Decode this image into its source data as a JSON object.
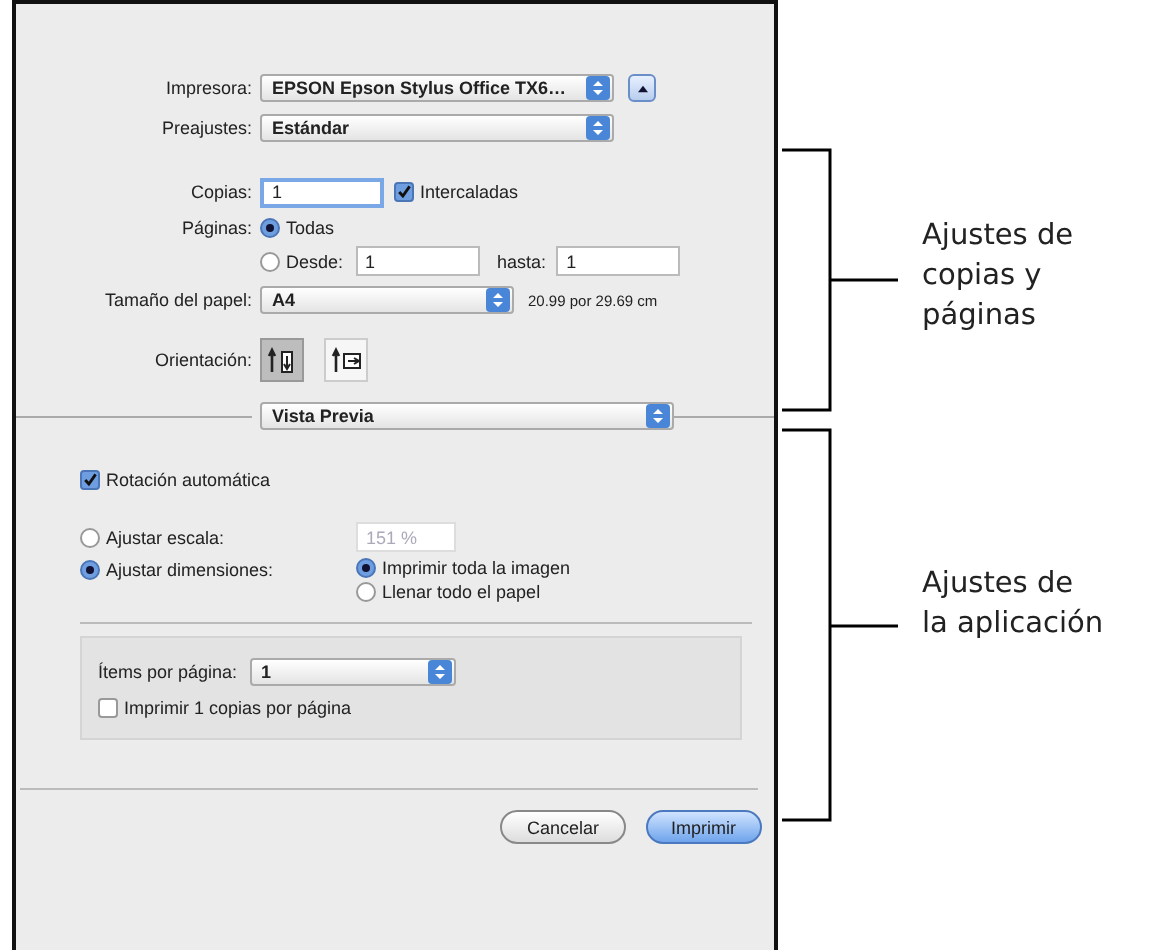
{
  "dialog": {
    "printer": {
      "label": "Impresora:",
      "value": "EPSON Epson Stylus Office TX6…"
    },
    "presets": {
      "label": "Preajustes:",
      "value": "Estándar"
    },
    "copies": {
      "label": "Copias:",
      "value": "1",
      "collated": {
        "label": "Intercaladas",
        "checked": true
      }
    },
    "pages": {
      "label": "Páginas:",
      "options": [
        {
          "label": "Todas",
          "selected": true
        },
        {
          "label": "Desde:",
          "selected": false
        }
      ],
      "from": "1",
      "to_label": "hasta:",
      "to": "1"
    },
    "paper_size": {
      "label": "Tamaño del papel:",
      "value": "A4",
      "dimensions": "20.99 por 29.69 cm"
    },
    "orientation": {
      "label": "Orientación:",
      "options": [
        {
          "selected": true
        },
        {
          "selected": false
        }
      ]
    },
    "section_popup": {
      "value": "Vista Previa"
    },
    "auto_rotate": {
      "label": "Rotación automática",
      "checked": true
    },
    "scale": {
      "label": "Ajustar escala:",
      "selected": false,
      "value": "151 %",
      "disabled": true
    },
    "fit": {
      "label": "Ajustar dimensiones:",
      "selected": true,
      "options": [
        {
          "label": "Imprimir toda la imagen",
          "selected": true
        },
        {
          "label": "Llenar todo el papel",
          "selected": false
        }
      ]
    },
    "items_per_page": {
      "label": "Ítems por página:",
      "value": "1"
    },
    "print_copies_per_page": {
      "label": "Imprimir 1 copias por página",
      "checked": false
    },
    "buttons": [
      {
        "label": "Cancelar",
        "default": false
      },
      {
        "label": "Imprimir",
        "default": true
      }
    ]
  },
  "annotations": [
    {
      "text": "Ajustes de\ncopias y\npáginas"
    },
    {
      "text": "Ajustes de\nla aplicación"
    }
  ]
}
